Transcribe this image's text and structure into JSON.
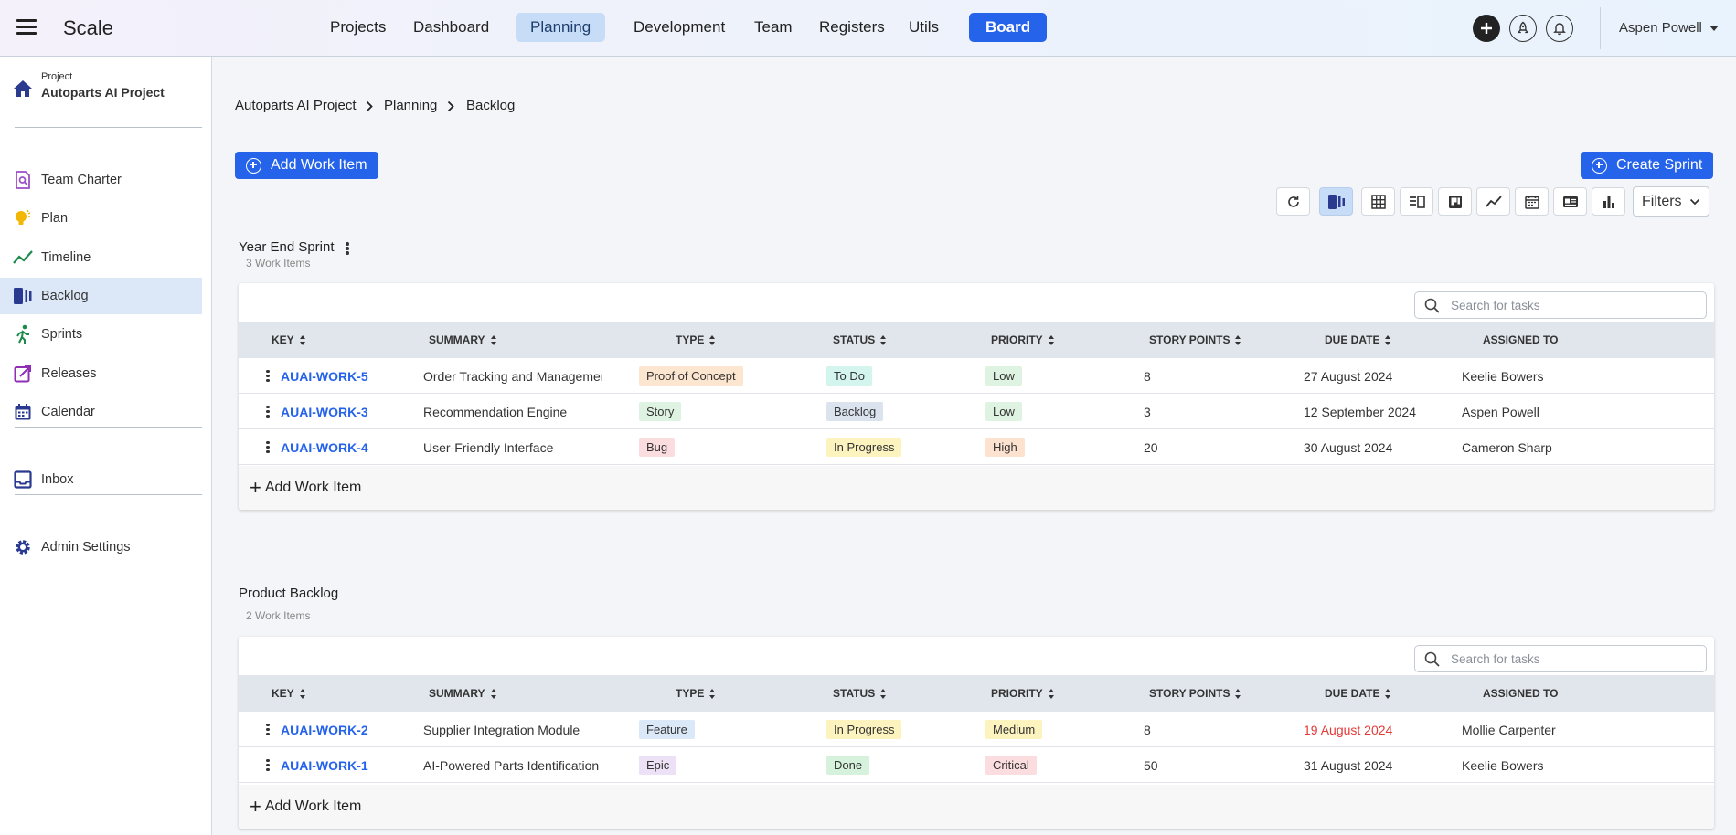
{
  "app": {
    "brand": "Scale"
  },
  "nav": {
    "items": [
      "Projects",
      "Dashboard",
      "Planning",
      "Development",
      "Team",
      "Registers",
      "Utils",
      "Board"
    ],
    "active": "Planning"
  },
  "header": {
    "icons": [
      "add-icon",
      "rocket-icon",
      "bell-icon"
    ],
    "user": "Aspen Powell"
  },
  "sidebar": {
    "project_label": "Project",
    "project_name": "Autoparts AI Project",
    "items": [
      {
        "label": "Team Charter",
        "icon": "team-charter-icon"
      },
      {
        "label": "Plan",
        "icon": "lightbulb-icon"
      },
      {
        "label": "Timeline",
        "icon": "timeline-icon"
      },
      {
        "label": "Backlog",
        "icon": "backlog-icon"
      },
      {
        "label": "Sprints",
        "icon": "runner-icon"
      },
      {
        "label": "Releases",
        "icon": "release-icon"
      },
      {
        "label": "Calendar",
        "icon": "calendar-icon"
      }
    ],
    "inbox": "Inbox",
    "admin": "Admin Settings",
    "active": "Backlog"
  },
  "breadcrumb": [
    "Autoparts AI Project",
    "Planning",
    "Backlog"
  ],
  "actions": {
    "add_work_item": "Add Work Item",
    "create_sprint": "Create Sprint",
    "filters": "Filters"
  },
  "columns": [
    "KEY",
    "SUMMARY",
    "TYPE",
    "STATUS",
    "PRIORITY",
    "STORY POINTS",
    "DUE DATE",
    "ASSIGNED TO"
  ],
  "search_placeholder": "Search for tasks",
  "add_row_label": "Add Work Item",
  "sections": [
    {
      "title": "Year End Sprint",
      "count": "3 Work Items",
      "rows": [
        {
          "key": "AUAI-WORK-5",
          "summary": "Order Tracking and Management",
          "type": "Proof of Concept",
          "status": "To Do",
          "priority": "Low",
          "points": "8",
          "due": "27 August 2024",
          "assigned": "Keelie Bowers"
        },
        {
          "key": "AUAI-WORK-3",
          "summary": "Recommendation Engine",
          "type": "Story",
          "status": "Backlog",
          "priority": "Low",
          "points": "3",
          "due": "12 September 2024",
          "assigned": "Aspen Powell"
        },
        {
          "key": "AUAI-WORK-4",
          "summary": "User-Friendly Interface",
          "type": "Bug",
          "status": "In Progress",
          "priority": "High",
          "points": "20",
          "due": "30 August 2024",
          "assigned": "Cameron Sharp"
        }
      ]
    },
    {
      "title": "Product Backlog",
      "count": "2 Work Items",
      "rows": [
        {
          "key": "AUAI-WORK-2",
          "summary": "Supplier Integration Module",
          "type": "Feature",
          "status": "In Progress",
          "priority": "Medium",
          "points": "8",
          "due": "19 August 2024",
          "due_overdue": true,
          "assigned": "Mollie Carpenter"
        },
        {
          "key": "AUAI-WORK-1",
          "summary": "AI-Powered Parts Identification",
          "type": "Epic",
          "status": "Done",
          "priority": "Critical",
          "points": "50",
          "due": "31 August 2024",
          "assigned": "Keelie Bowers"
        }
      ]
    }
  ],
  "tag_colors": {
    "Proof of Concept": "#fde6cf",
    "Story": "#dff3e2",
    "Bug": "#fbdde0",
    "Feature": "#dbe8f8",
    "Epic": "#ece1f6",
    "To Do": "#d4f4ee",
    "Backlog": "#dbe3ef",
    "In Progress": "#fdf3bf",
    "Done": "#d7f2dc",
    "Low": "#dff3e2",
    "High": "#fde2cf",
    "Medium": "#fdf3bf",
    "Critical": "#fbdde0"
  },
  "colors": {
    "accent": "#2563eb",
    "overdue": "#e53935"
  }
}
